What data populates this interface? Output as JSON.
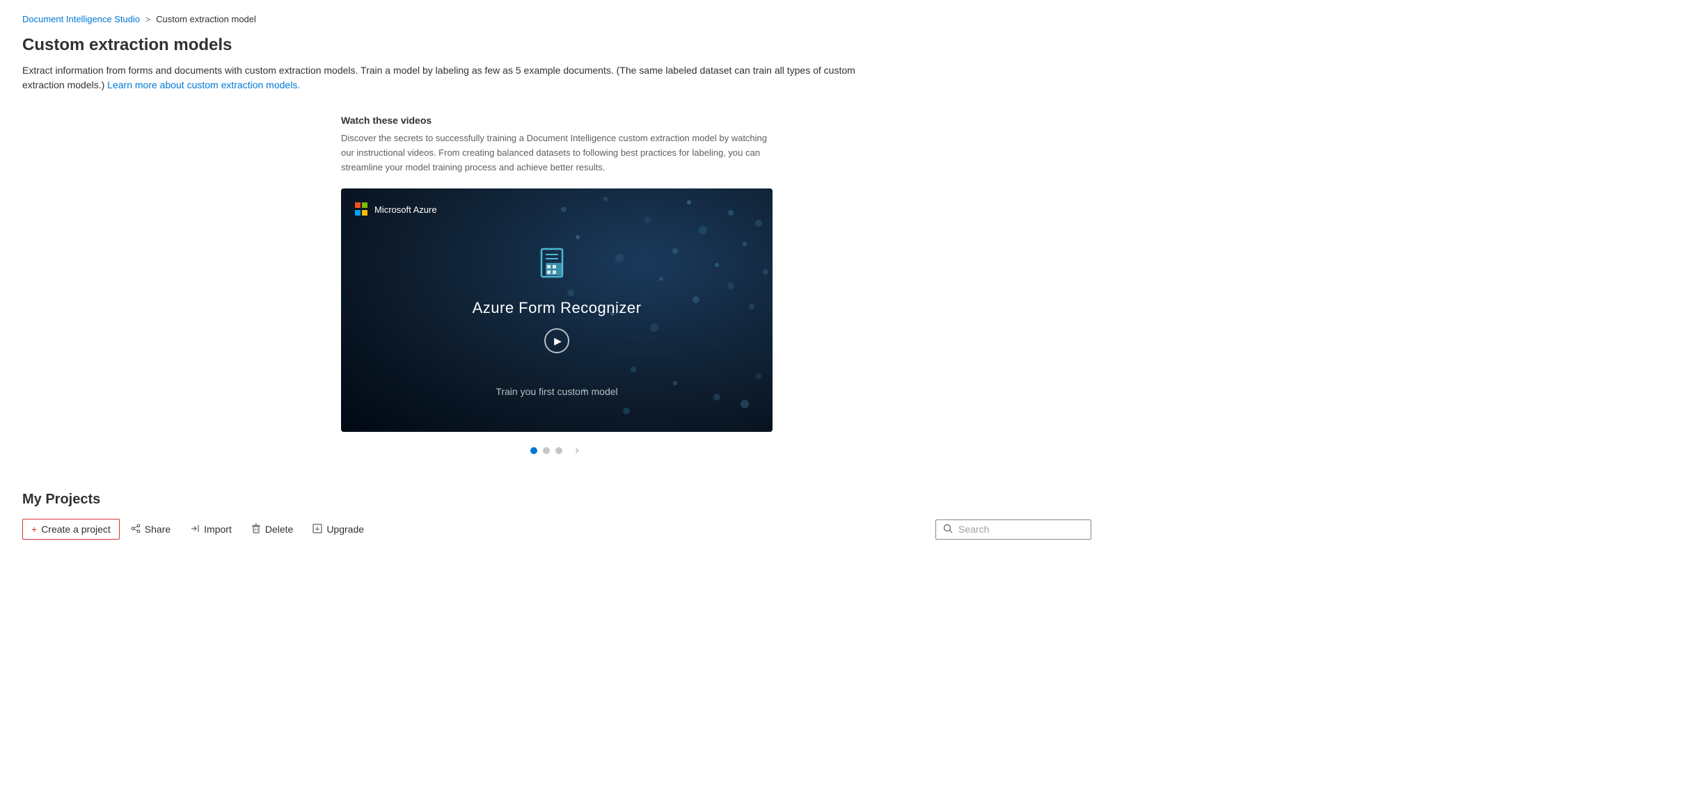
{
  "breadcrumb": {
    "link_label": "Document Intelligence Studio",
    "separator": ">",
    "current": "Custom extraction model"
  },
  "page": {
    "title": "Custom extraction models",
    "description": "Extract information from forms and documents with custom extraction models. Train a model by labeling as few as 5 example documents. (The same labeled dataset can train all types of custom extraction models.)",
    "description_link": "Learn more about custom extraction models."
  },
  "video_section": {
    "info_title": "Watch these videos",
    "info_text": "Discover the secrets to successfully training a Document Intelligence custom extraction model by watching our instructional videos. From creating balanced datasets to following best practices for labeling, you can streamline your model training process and achieve better results.",
    "video_title": "Azure Form Recognizer",
    "video_subtitle": "Train you first custom model",
    "video_logo_text": "Microsoft Azure"
  },
  "carousel": {
    "dots": [
      "active",
      "inactive",
      "inactive"
    ],
    "next_label": "›"
  },
  "projects": {
    "title": "My Projects",
    "toolbar": {
      "create_label": "Create a project",
      "share_label": "Share",
      "import_label": "Import",
      "delete_label": "Delete",
      "upgrade_label": "Upgrade"
    },
    "search": {
      "placeholder": "Search"
    }
  }
}
